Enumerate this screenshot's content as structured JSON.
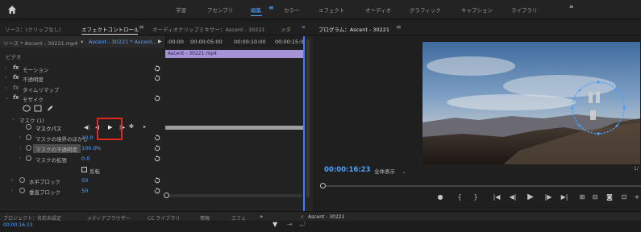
{
  "topbar": {
    "tabs": [
      "学習",
      "アセンブリ",
      "編集",
      "カラー",
      "エフェクト",
      "オーディオ",
      "グラフィック",
      "キャプション",
      "ライブラリ"
    ],
    "active_index": 2,
    "more_label": "»"
  },
  "left_panel": {
    "tabs": [
      "ソース：(クリップなし)",
      "エフェクトコントロール",
      "オーディオクリップミキサー：Ascent - 30221",
      "メタ"
    ],
    "active_tab": 1,
    "menu_glyph": "≡",
    "more_label": "»",
    "source_clip": "ソース * Ascent - 30221.mp4",
    "sequence_clip": "Ascent - 30221 * Ascent...",
    "ruler_times": [
      ":00:00",
      "00:00:05:00",
      "00:00:10:00",
      "00:00:15:00"
    ],
    "clip_name": "Ascent - 30221.mp4",
    "section_video": "ビデオ",
    "effects": {
      "motion": "モーション",
      "opacity": "不透明度",
      "time_remap": "タイムリマップ",
      "mosaic": "モザイク"
    },
    "mask": {
      "title": "マスク (1)",
      "path_label": "マスクパス",
      "feather_label": "マスクの境界のぼかし",
      "feather_value": "10.0",
      "opacity_label": "マスクの不透明度",
      "opacity_value": "100.0",
      "opacity_unit": "%",
      "expansion_label": "マスクの拡張",
      "expansion_value": "0.0",
      "inverted_label": "反転"
    },
    "horizontal_blocks": {
      "label": "水平ブロック",
      "value": "50"
    },
    "vertical_blocks": {
      "label": "垂直ブロック",
      "value": "50"
    },
    "status_time": "00:00:16:23"
  },
  "program": {
    "title": "プログラム：Ascent - 30221",
    "menu_glyph": "≡",
    "timecode": "00:00:16:23",
    "fit_label": "全体表示",
    "fit_side_label": "1/"
  },
  "bottom_tabs": [
    "プロジェクト：名前未設定",
    "メディアブラウザー",
    "CC ライブラリ",
    "情報",
    "エフェ",
    "Ascent - 30221"
  ],
  "bottom_more": "»",
  "colors": {
    "accent_blue": "#4ea2ff",
    "clip_purple": "#a593d8",
    "highlight_red": "#e0281c",
    "panel_bg": "#222222"
  }
}
